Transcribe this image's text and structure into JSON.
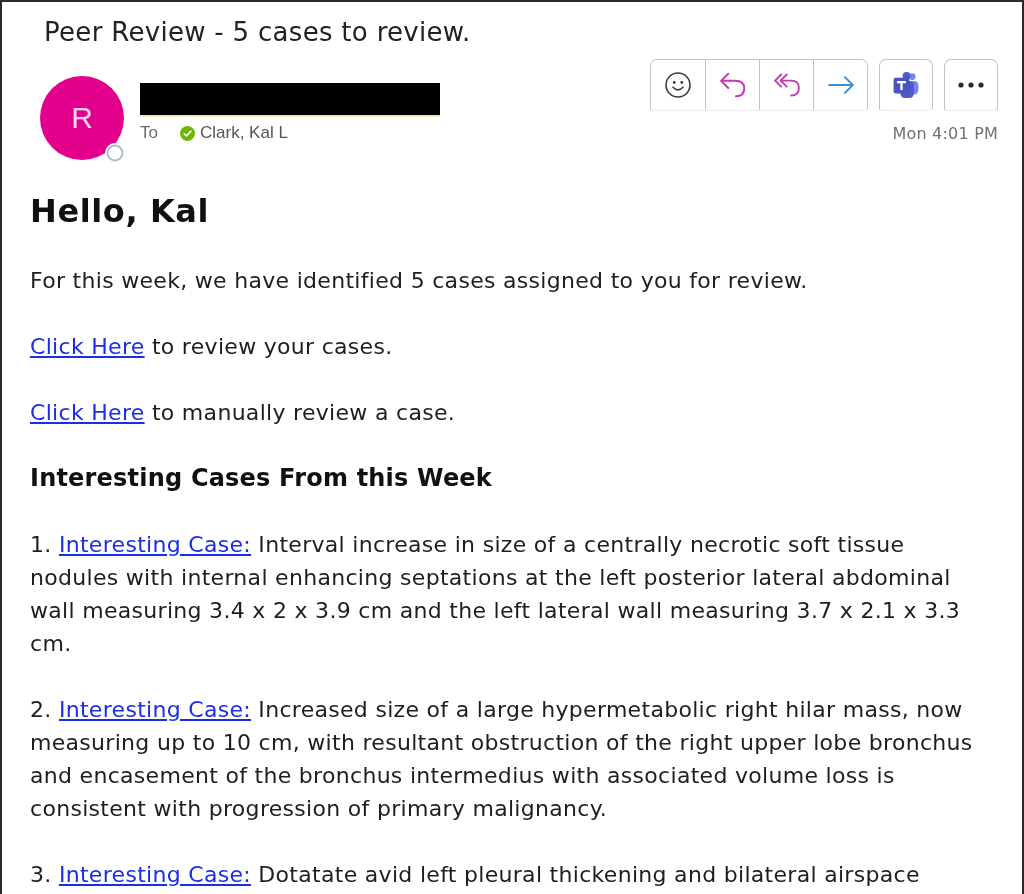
{
  "email": {
    "subject": "Peer Review - 5 cases to review.",
    "sender": {
      "initial": "R",
      "available": false,
      "name_redacted": true
    },
    "recipients_label": "To",
    "recipients": [
      {
        "name": "Clark, Kal L",
        "available": true
      }
    ],
    "time": "Mon 4:01 PM"
  },
  "body": {
    "greeting": "Hello, Kal",
    "intro": "For this week, we have identified 5 cases assigned to you for review.",
    "link_lines": [
      {
        "link": "Click Here",
        "text": "to review your cases."
      },
      {
        "link": "Click Here",
        "text": "to manually review a case."
      }
    ],
    "section_heading": "Interesting Cases From this Week",
    "cases": [
      {
        "number": "1.",
        "link": "Interesting Case:",
        "text": "Interval increase in size of a centrally necrotic soft tissue nodules with internal enhancing septations at the left posterior lateral abdominal wall measuring 3.4 x 2 x 3.9 cm and the left lateral wall measuring 3.7 x 2.1 x 3.3 cm."
      },
      {
        "number": "2.",
        "link": "Interesting Case:",
        "text": "Increased size of a large hypermetabolic right hilar mass, now measuring up to 10 cm, with resultant obstruction of the right upper lobe bronchus and encasement of the bronchus intermedius with associated volume loss is consistent with progression of primary malignancy."
      },
      {
        "number": "3.",
        "link": "Interesting Case:",
        "text": "Dotatate avid left pleural thickening and bilateral airspace"
      }
    ]
  }
}
